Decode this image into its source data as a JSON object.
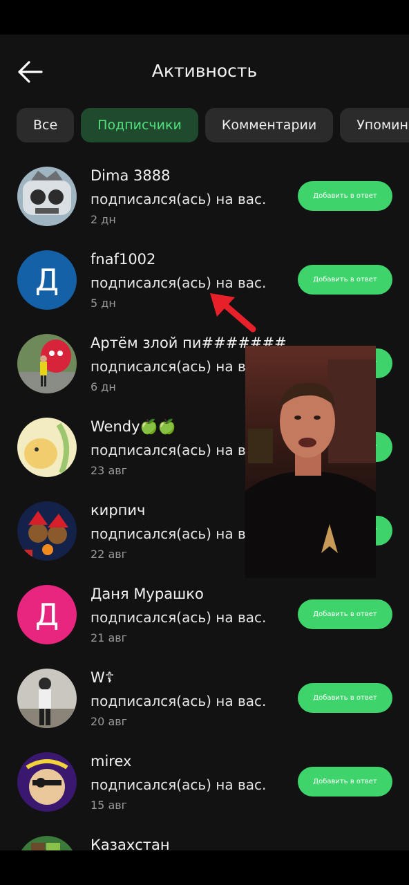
{
  "header": {
    "title": "Активность"
  },
  "tabs": [
    {
      "label": "Все"
    },
    {
      "label": "Подписчики"
    },
    {
      "label": "Комментарии"
    },
    {
      "label": "Упомина"
    }
  ],
  "button_label": "Добавить в ответ",
  "followers": [
    {
      "name": "Dima 3888",
      "action": "подписался(ась) на вас.",
      "time": "2 дн"
    },
    {
      "name": "fnaf1002",
      "action": "подписался(ась) на вас.",
      "time": "5 дн",
      "avatar_letter": "Д",
      "avatar_color": "#1461a8"
    },
    {
      "name": "Артём злой пи#######",
      "action": "подписался(ась) на вас.",
      "time": "6 дн"
    },
    {
      "name": "Wendy🍏🍏",
      "action": "подписался(ась) на вас.",
      "time": "23 авг"
    },
    {
      "name": "кирпич",
      "action": "подписался(ась) на вас.",
      "time": "22 авг"
    },
    {
      "name": "Даня Мурашко",
      "action": "подписался(ась) на вас.",
      "time": "21 авг",
      "avatar_letter": "Д",
      "avatar_color": "#e8257f"
    },
    {
      "name": "W☦",
      "action": "подписался(ась) на вас.",
      "time": "20 авг"
    },
    {
      "name": "mirex",
      "action": "подписался(ась) на вас.",
      "time": "15 авг"
    },
    {
      "name": "Казахстан",
      "action": "",
      "time": ""
    }
  ],
  "colors": {
    "accent": "#3ed46b",
    "active_tab_text": "#52e07e",
    "arrow": "#e8202a"
  }
}
